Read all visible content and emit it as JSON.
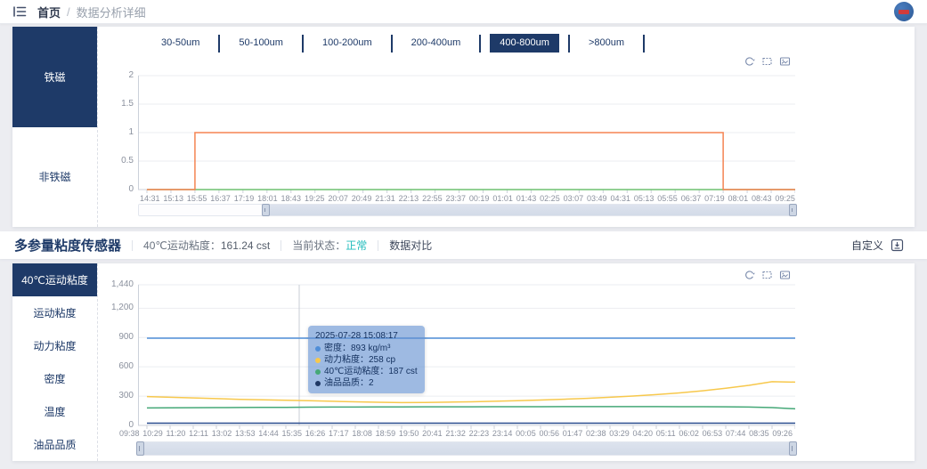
{
  "colors": {
    "navy": "#1e3a68",
    "orange": "#f58452",
    "green_zero": "#6ec071",
    "blue": "#4f8ed8",
    "yellow": "#f7c84c",
    "green": "#45a877",
    "dark_series": "#2a4d8f",
    "status_ok": "#21bcbc"
  },
  "topbar": {
    "menu_icon": "menu-fold-icon",
    "avatar_icon": "user-avatar",
    "breadcrumb": {
      "home": "首页",
      "separator": "/",
      "current": "数据分析详细"
    }
  },
  "panel1": {
    "side_tabs": [
      {
        "label": "铁磁",
        "active": true
      },
      {
        "label": "非铁磁",
        "active": false
      }
    ],
    "size_tabs": [
      {
        "label": "30-50um",
        "active": false
      },
      {
        "label": "50-100um",
        "active": false
      },
      {
        "label": "100-200um",
        "active": false
      },
      {
        "label": "200-400um",
        "active": false
      },
      {
        "label": "400-800um",
        "active": true
      },
      {
        "label": ">800um",
        "active": false
      }
    ],
    "toolbox_icons": [
      "restore-icon",
      "box-select-icon",
      "save-image-icon"
    ]
  },
  "section_header": {
    "title": "多参量粘度传感器",
    "metric_label": "40℃运动粘度：",
    "metric_value": "161.24 cst",
    "status_label": "当前状态：",
    "status_value": "正常",
    "compare_label": "数据对比",
    "customize_label": "自定义",
    "customize_icon": "export-box-icon"
  },
  "panel2": {
    "side_tabs": [
      {
        "label": "40℃运动粘度",
        "active": true
      },
      {
        "label": "运动粘度",
        "active": false
      },
      {
        "label": "动力粘度",
        "active": false
      },
      {
        "label": "密度",
        "active": false
      },
      {
        "label": "温度",
        "active": false
      },
      {
        "label": "油品品质",
        "active": false
      }
    ],
    "toolbox_icons": [
      "restore-icon",
      "box-select-icon",
      "save-image-icon"
    ]
  },
  "tooltip": {
    "timestamp": "2025-07-28 15:08:17",
    "rows": [
      {
        "label": "密度",
        "value": "893 kg/m³",
        "color": "#4f8ed8"
      },
      {
        "label": "动力粘度",
        "value": "258 cp",
        "color": "#f7c84c"
      },
      {
        "label": "40℃运动粘度",
        "value": "187 cst",
        "color": "#45a877"
      },
      {
        "label": "油品品质",
        "value": "2",
        "color": "#1f3864"
      }
    ]
  },
  "chart_data": [
    {
      "type": "line",
      "step": true,
      "x": [
        "14:31",
        "15:13",
        "15:55",
        "16:37",
        "17:19",
        "18:01",
        "18:43",
        "19:25",
        "20:07",
        "20:49",
        "21:31",
        "22:13",
        "22:55",
        "23:37",
        "00:19",
        "01:01",
        "01:43",
        "02:25",
        "03:07",
        "03:49",
        "04:31",
        "05:13",
        "05:55",
        "06:37",
        "07:19",
        "08:01",
        "08:43",
        "09:25"
      ],
      "ylim": [
        0,
        2
      ],
      "yticks": [
        0,
        0.5,
        1,
        1.5,
        2
      ],
      "ytick_labels": [
        "0",
        "0.5",
        "1",
        "1.5",
        "2"
      ],
      "grid": true,
      "legend": "none",
      "series": [
        {
          "name": "",
          "color": "#6ec071",
          "values": [
            0,
            0,
            0,
            0,
            0,
            0,
            0,
            0,
            0,
            0,
            0,
            0,
            0,
            0,
            0,
            0,
            0,
            0,
            0,
            0,
            0,
            0,
            0,
            0,
            0,
            0,
            0,
            0
          ]
        },
        {
          "name": "",
          "color": "#f58452",
          "values": [
            0,
            0,
            1,
            1,
            1,
            1,
            1,
            1,
            1,
            1,
            1,
            1,
            1,
            1,
            1,
            1,
            1,
            1,
            1,
            1,
            1,
            1,
            1,
            1,
            0,
            0,
            0,
            0
          ]
        }
      ]
    },
    {
      "type": "line",
      "step": false,
      "x": [
        "09:38",
        "10:29",
        "11:20",
        "12:11",
        "13:02",
        "13:53",
        "14:44",
        "15:35",
        "16:26",
        "17:17",
        "18:08",
        "18:59",
        "19:50",
        "20:41",
        "21:32",
        "22:23",
        "23:14",
        "00:05",
        "00:56",
        "01:47",
        "02:38",
        "03:29",
        "04:20",
        "05:11",
        "06:02",
        "06:53",
        "07:44",
        "08:35",
        "09:26"
      ],
      "ylim": [
        0,
        1440
      ],
      "yticks": [
        0,
        300,
        600,
        900,
        1200,
        1440
      ],
      "ytick_labels": [
        "0",
        "300",
        "600",
        "900",
        "1,200",
        "1,440"
      ],
      "grid": true,
      "legend": "none",
      "series": [
        {
          "name": "密度",
          "unit": "kg/m³",
          "color": "#4f8ed8",
          "values": [
            893,
            893,
            893,
            893,
            893,
            893,
            893,
            893,
            893,
            893,
            893,
            893,
            893,
            893,
            893,
            893,
            893,
            893,
            893,
            893,
            893,
            893,
            893,
            893,
            893,
            893,
            893,
            893,
            893
          ]
        },
        {
          "name": "动力粘度",
          "unit": "cp",
          "color": "#f7c84c",
          "values": [
            295,
            288,
            281,
            274,
            267,
            262,
            258,
            253,
            247,
            241,
            237,
            234,
            235,
            238,
            242,
            247,
            253,
            260,
            268,
            277,
            288,
            301,
            316,
            333,
            354,
            380,
            410,
            448,
            443
          ]
        },
        {
          "name": "40℃运动粘度",
          "unit": "cst",
          "color": "#45a877",
          "values": [
            179,
            180,
            181,
            182,
            183,
            184,
            185,
            187,
            188,
            188,
            189,
            189,
            190,
            190,
            190,
            191,
            191,
            191,
            192,
            192,
            192,
            192,
            192,
            191,
            191,
            190,
            188,
            182,
            170
          ]
        },
        {
          "name": "油品品质",
          "unit": "",
          "color": "#2a4d8f",
          "values": [
            2,
            2,
            2,
            2,
            2,
            2,
            2,
            2,
            2,
            2,
            2,
            2,
            2,
            2,
            2,
            2,
            2,
            2,
            2,
            2,
            2,
            2,
            2,
            2,
            2,
            2,
            2,
            2,
            2
          ]
        }
      ]
    }
  ]
}
